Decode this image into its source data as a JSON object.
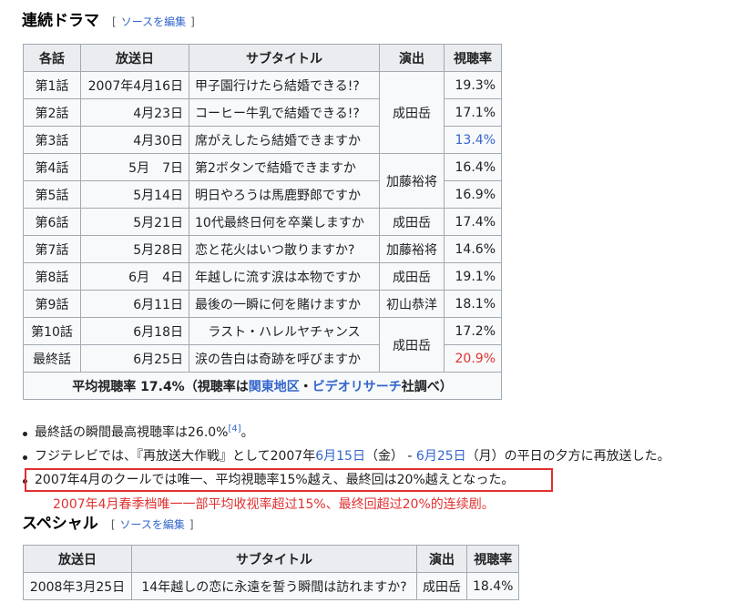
{
  "drama": {
    "title": "連続ドラマ",
    "edit_open": "[",
    "edit_label": "ソースを編集",
    "edit_close": "]",
    "headers": [
      "各話",
      "放送日",
      "サブタイトル",
      "演出",
      "視聴率"
    ],
    "rows": [
      {
        "ep": "第1話",
        "date": "2007年4月16日",
        "subtitle": "甲子園行けたら結婚できる!?",
        "rate": "19.3%"
      },
      {
        "ep": "第2話",
        "date": "4月23日",
        "subtitle": "コーヒー牛乳で結婚できる!?",
        "rate": "17.1%"
      },
      {
        "ep": "第3話",
        "date": "4月30日",
        "subtitle": "席がえしたら結婚できますか",
        "rate": "13.4%"
      },
      {
        "ep": "第4話",
        "date": "5月　7日",
        "subtitle": "第2ボタンで結婚できますか",
        "rate": "16.4%"
      },
      {
        "ep": "第5話",
        "date": "5月14日",
        "subtitle": "明日やろうは馬鹿野郎ですか",
        "rate": "16.9%"
      },
      {
        "ep": "第6話",
        "date": "5月21日",
        "subtitle": "10代最終日何を卒業しますか",
        "rate": "17.4%"
      },
      {
        "ep": "第7話",
        "date": "5月28日",
        "subtitle": "恋と花火はいつ散りますか?",
        "rate": "14.6%"
      },
      {
        "ep": "第8話",
        "date": "6月　4日",
        "subtitle": "年越しに流す涙は本物ですか",
        "rate": "19.1%"
      },
      {
        "ep": "第9話",
        "date": "6月11日",
        "subtitle": "最後の一瞬に何を賭けますか",
        "rate": "18.1%"
      },
      {
        "ep": "第10話",
        "date": "6月18日",
        "subtitle": "ラスト・ハレルヤチャンス",
        "rate": "17.2%"
      },
      {
        "ep": "最終話",
        "date": "6月25日",
        "subtitle": "涙の告白は奇跡を呼びますか",
        "rate": "20.9%"
      }
    ],
    "directors": {
      "d1": "成田岳",
      "d2": "加藤裕将",
      "d3": "成田岳",
      "d4": "加藤裕将",
      "d5": "成田岳",
      "d6": "初山恭洋",
      "d7": "成田岳"
    },
    "summary": {
      "prefix": "平均視聴率 17.4%（視聴率は",
      "link1": "関東地区",
      "sep": "・",
      "link2": "ビデオリサーチ",
      "suffix": "社調べ）"
    },
    "rate_colors": {
      "low": "#3366cc",
      "high": "#dd3333"
    }
  },
  "notes": {
    "n1_text": "最終話の瞬間最高視聴率は26.0%",
    "n1_ref": "[4]",
    "n1_end": "。",
    "n2_a": "フジテレビでは、『再放送大作戦』として2007年",
    "n2_link1": "6月15日",
    "n2_b": "（金） - ",
    "n2_link2": "6月25日",
    "n2_c": "（月）の平日の夕方に再放送した。",
    "n3_text": "2007年4月のクールでは唯一、平均視聴率15%越え、最終回は20%越えとなった。"
  },
  "annotation": "2007年4月春季档唯一一部平均收视率超过15%、最终回超过20%的连续剧。",
  "special": {
    "title": "スペシャル",
    "edit_open": "[",
    "edit_label": "ソースを編集",
    "edit_close": "]",
    "headers": [
      "放送日",
      "サブタイトル",
      "演出",
      "視聴率"
    ],
    "row": {
      "date": "2008年3月25日",
      "subtitle": "14年越しの恋に永遠を誓う瞬間は訪れますか?",
      "director": "成田岳",
      "rate": "18.4%"
    }
  }
}
